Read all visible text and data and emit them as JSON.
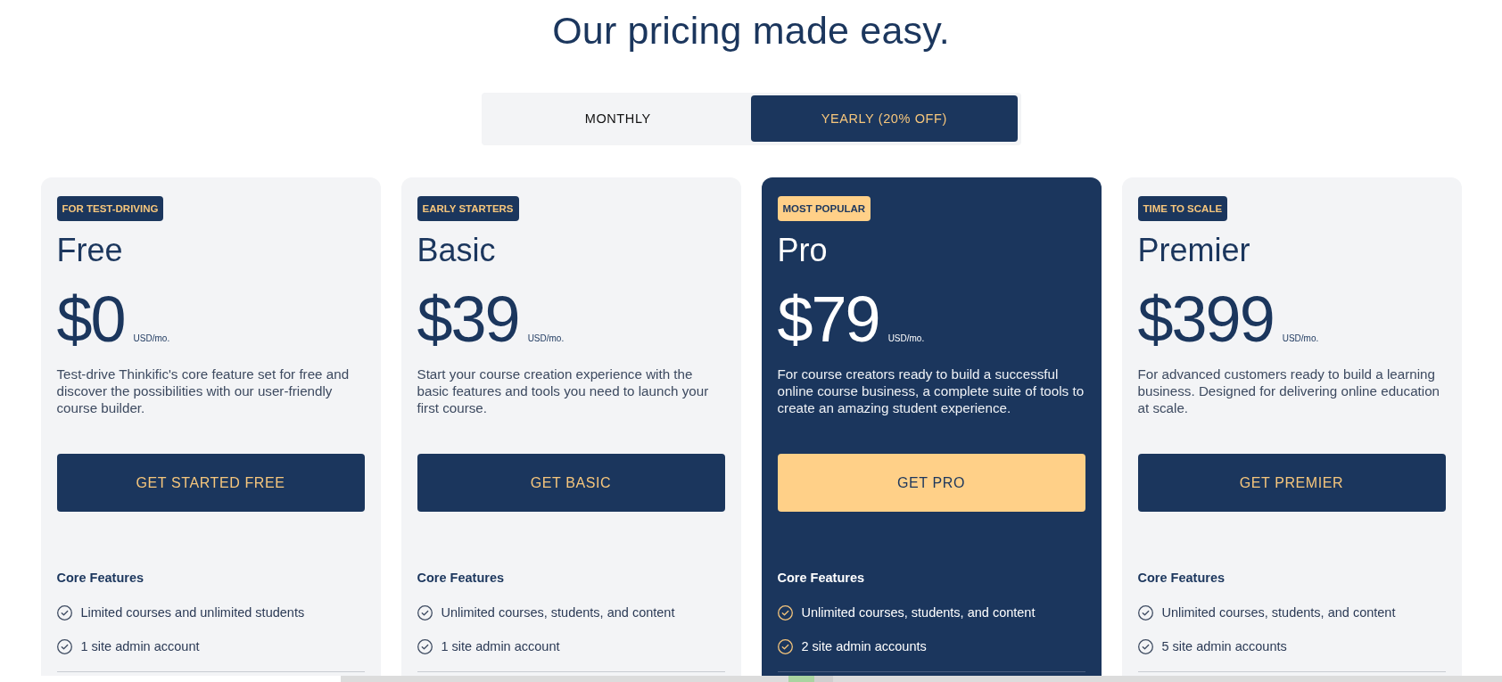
{
  "heading": "Our pricing made easy.",
  "billing_toggle": [
    {
      "label": "MONTHLY",
      "selected": false
    },
    {
      "label": "YEARLY (20% OFF)",
      "selected": true
    }
  ],
  "plans": [
    {
      "badge": "FOR TEST-DRIVING",
      "name": "Free",
      "price": "$0",
      "unit": "USD/mo.",
      "description": "Test-drive Thinkific's core feature set for free and discover the possibilities with our user-friendly course builder.",
      "button": "GET STARTED FREE",
      "featured": false,
      "features_heading": "Core Features",
      "features": [
        "Limited courses and unlimited students",
        "1 site admin account"
      ]
    },
    {
      "badge": "EARLY STARTERS",
      "name": "Basic",
      "price": "$39",
      "unit": "USD/mo.",
      "description": "Start your course creation experience with the basic features and tools you need to launch your first course.",
      "button": "GET BASIC",
      "featured": false,
      "features_heading": "Core Features",
      "features": [
        "Unlimited courses, students, and content",
        "1 site admin account"
      ]
    },
    {
      "badge": "MOST POPULAR",
      "name": "Pro",
      "price": "$79",
      "unit": "USD/mo.",
      "description": "For course creators ready to build a successful online course business, a complete suite of tools to create an amazing student experience.",
      "button": "GET PRO",
      "featured": true,
      "features_heading": "Core Features",
      "features": [
        "Unlimited courses, students, and content",
        "2 site admin accounts"
      ]
    },
    {
      "badge": "TIME TO SCALE",
      "name": "Premier",
      "price": "$399",
      "unit": "USD/mo.",
      "description": "For advanced customers ready to build a learning business. Designed for delivering online education at scale.",
      "button": "GET PREMIER",
      "featured": false,
      "features_heading": "Core Features",
      "features": [
        "Unlimited courses, students, and content",
        "5 site admin accounts"
      ]
    }
  ]
}
